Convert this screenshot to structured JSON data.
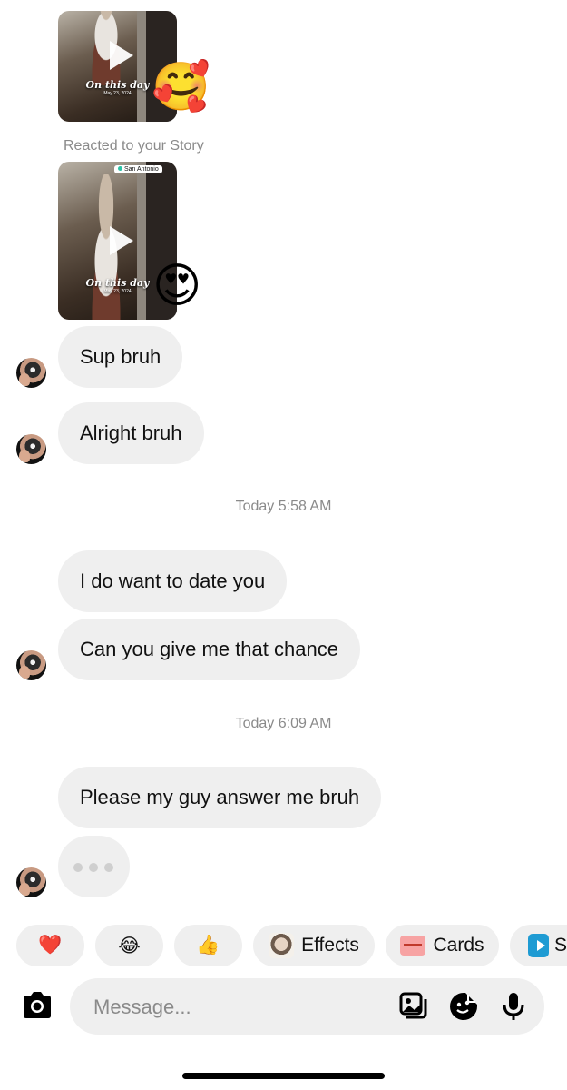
{
  "stories": [
    {
      "caption": "On this day",
      "date": "May 23, 2024",
      "reaction": "🥰"
    },
    {
      "location": "San Antonio",
      "caption": "On this day",
      "date": "May 23, 2024",
      "reaction": "😍"
    }
  ],
  "reacted_label": "Reacted to your Story",
  "messages": [
    {
      "text": "Sup bruh"
    },
    {
      "text": "Alright bruh"
    },
    {
      "text": "I do want to date you"
    },
    {
      "text": "Can you give me that chance"
    },
    {
      "text": "Please my guy answer me bruh"
    }
  ],
  "timestamps": [
    "Today 5:58 AM",
    "Today 6:09 AM"
  ],
  "quick_reactions": {
    "heart": "❤️",
    "laugh": "😂",
    "thumbs": "👍",
    "effects_label": "Effects",
    "cards_label": "Cards",
    "partial_label": "S"
  },
  "composer": {
    "placeholder": "Message..."
  }
}
